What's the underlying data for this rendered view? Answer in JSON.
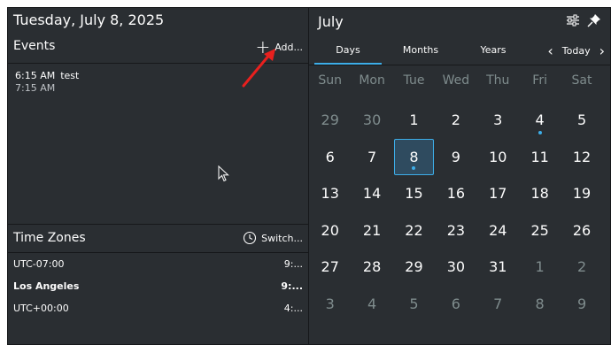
{
  "left": {
    "date_title": "Tuesday, July 8, 2025",
    "events_label": "Events",
    "add_label": "Add...",
    "event": {
      "start": "6:15 AM",
      "title": "test",
      "end": "7:15 AM"
    },
    "tz_label": "Time Zones",
    "switch_label": "Switch...",
    "timezones": [
      {
        "name": "UTC-07:00",
        "time": "9:..."
      },
      {
        "name": "Los Angeles",
        "time": "9:..."
      },
      {
        "name": "UTC+00:00",
        "time": "4:..."
      }
    ]
  },
  "right": {
    "month_title": "July",
    "tabs": [
      "Days",
      "Months",
      "Years"
    ],
    "today_label": "Today",
    "weekdays": [
      "Sun",
      "Mon",
      "Tue",
      "Wed",
      "Thu",
      "Fri",
      "Sat"
    ],
    "weeks": [
      [
        "29",
        "30",
        "1",
        "2",
        "3",
        "4",
        "5"
      ],
      [
        "6",
        "7",
        "8",
        "9",
        "10",
        "11",
        "12"
      ],
      [
        "13",
        "14",
        "15",
        "16",
        "17",
        "18",
        "19"
      ],
      [
        "20",
        "21",
        "22",
        "23",
        "24",
        "25",
        "26"
      ],
      [
        "27",
        "28",
        "29",
        "30",
        "31",
        "1",
        "2"
      ],
      [
        "3",
        "4",
        "5",
        "6",
        "7",
        "8",
        "9"
      ]
    ]
  },
  "colors": {
    "accent": "#3daee9",
    "background": "#2a2e32",
    "muted": "#7f8c8d"
  }
}
